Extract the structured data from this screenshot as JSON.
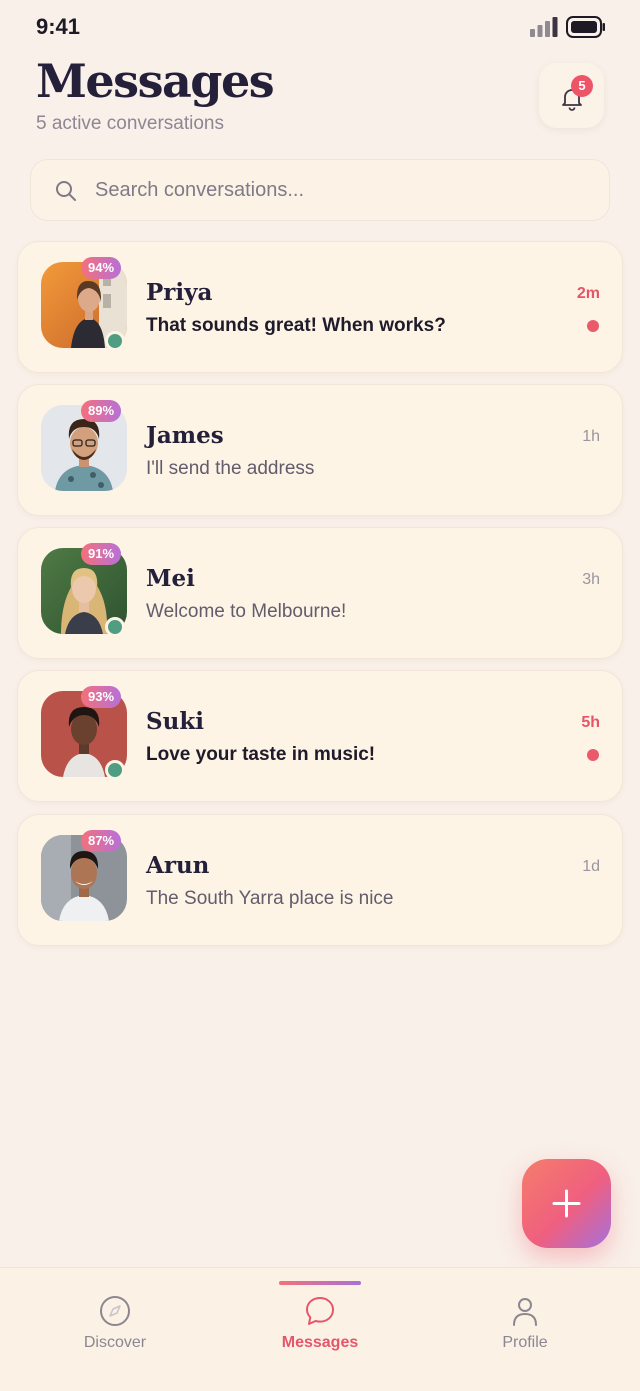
{
  "status_bar": {
    "time": "9:41"
  },
  "header": {
    "title": "Messages",
    "subtitle": "5 active conversations",
    "notification_count": "5"
  },
  "search": {
    "placeholder": "Search conversations..."
  },
  "conversations": [
    {
      "name": "Priya",
      "preview": "That sounds great! When works?",
      "time": "2m",
      "match": "94%",
      "online": true,
      "unread": true
    },
    {
      "name": "James",
      "preview": "I'll send the address",
      "time": "1h",
      "match": "89%",
      "online": false,
      "unread": false
    },
    {
      "name": "Mei",
      "preview": "Welcome to Melbourne!",
      "time": "3h",
      "match": "91%",
      "online": true,
      "unread": false
    },
    {
      "name": "Suki",
      "preview": "Love your taste in music!",
      "time": "5h",
      "match": "93%",
      "online": true,
      "unread": true
    },
    {
      "name": "Arun",
      "preview": "The South Yarra place is nice",
      "time": "1d",
      "match": "87%",
      "online": false,
      "unread": false
    }
  ],
  "bottom_nav": {
    "items": [
      {
        "label": "Discover",
        "icon": "compass-icon",
        "active": false
      },
      {
        "label": "Messages",
        "icon": "chat-bubble-icon",
        "active": true
      },
      {
        "label": "Profile",
        "icon": "person-icon",
        "active": false
      }
    ]
  },
  "fab": {
    "icon": "plus-icon"
  },
  "colors": {
    "accent": "#e6566b",
    "online": "#4f9e82",
    "background": "#f9f0e9",
    "card": "#fdf4e6",
    "gradient_start": "#f4707b",
    "gradient_end": "#a870d8"
  }
}
